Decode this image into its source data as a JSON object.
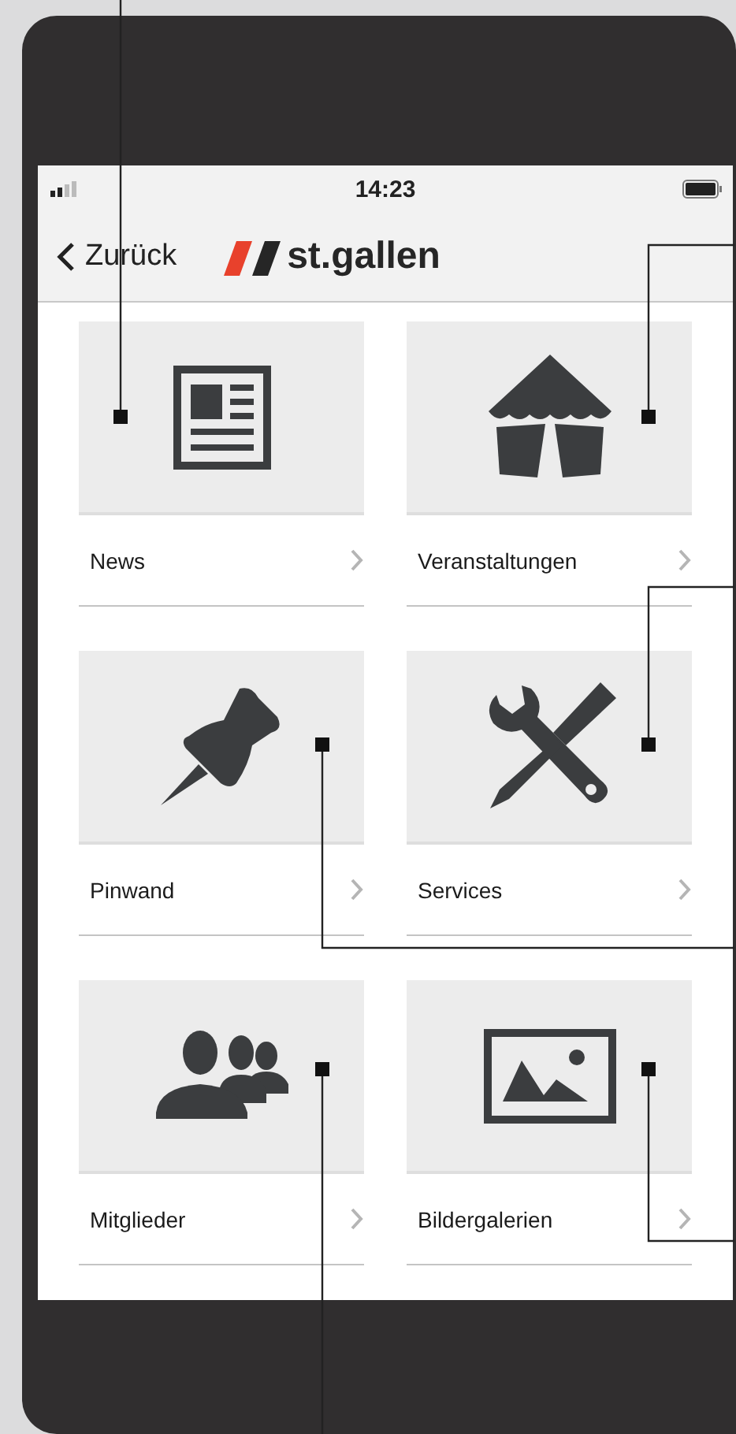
{
  "status_bar": {
    "time": "14:23"
  },
  "nav_bar": {
    "back_label": "Zurück",
    "logo_text": "st.gallen"
  },
  "tiles": [
    {
      "label": "News",
      "kind": "newspaper"
    },
    {
      "label": "Veranstaltungen",
      "kind": "tent"
    },
    {
      "label": "Pinwand",
      "kind": "pin"
    },
    {
      "label": "Services",
      "kind": "tools"
    },
    {
      "label": "Mitglieder",
      "kind": "people"
    },
    {
      "label": "Bildergalerien",
      "kind": "picture"
    }
  ]
}
